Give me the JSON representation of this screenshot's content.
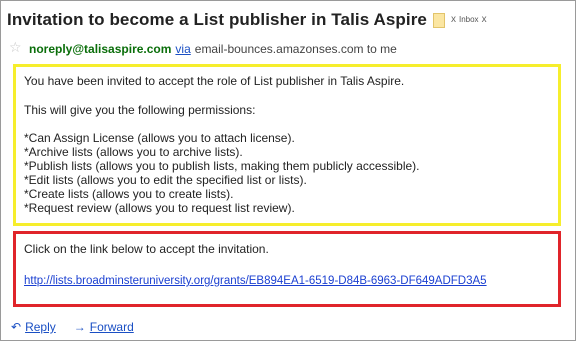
{
  "email": {
    "subject": "Invitation to become a List publisher in Talis Aspire",
    "labels": {
      "chip_close": "x",
      "inbox": "Inbox",
      "inbox_close": "x"
    },
    "sender": {
      "address": "noreply@talisaspire.com",
      "via_label": "via",
      "via_domain_and_recipient": "email-bounces.amazonses.com to me"
    },
    "intro": {
      "line1": "You have been invited to accept the role of List publisher in Talis Aspire.",
      "line2": "This will give you the following permissions:",
      "permissions": [
        "*Can Assign License (allows you to attach license).",
        "*Archive lists (allows you to archive lists).",
        "*Publish lists (allows you to publish lists, making them publicly accessible).",
        "*Edit lists (allows you to edit the specified list or lists).",
        "*Create lists (allows you to create lists).",
        "*Request review (allows you to request list review)."
      ]
    },
    "invite": {
      "instruction": "Click on the link below to accept the invitation.",
      "url": "http://lists.broadminsteruniversity.org/grants/EB894EA1-6519-D84B-6963-DF649ADFD3A5"
    },
    "actions": {
      "reply": "Reply",
      "forward": "Forward"
    },
    "colors": {
      "highlight_yellow": "#f6ee2c",
      "highlight_red": "#e0242a",
      "link_blue": "#1a3fd1",
      "sender_green": "#0a6e0a"
    }
  }
}
